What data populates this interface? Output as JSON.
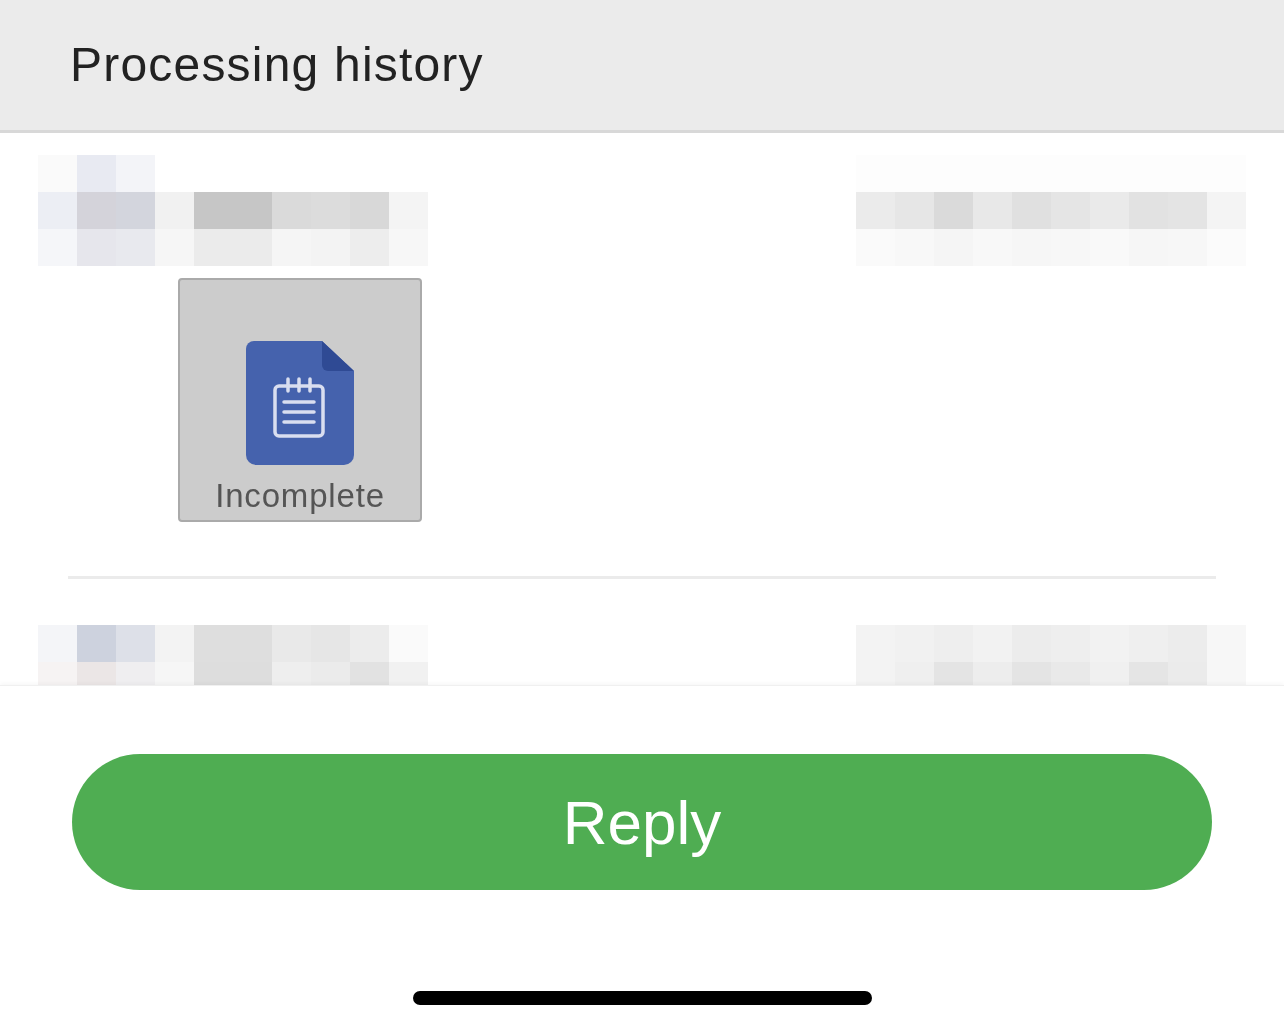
{
  "header": {
    "title": "Processing history"
  },
  "history": [
    {
      "kind": "attachment",
      "attachment": {
        "label": "Incomplete"
      }
    },
    {
      "kind": "cut_off"
    }
  ],
  "reply_button": {
    "label": "Reply"
  }
}
